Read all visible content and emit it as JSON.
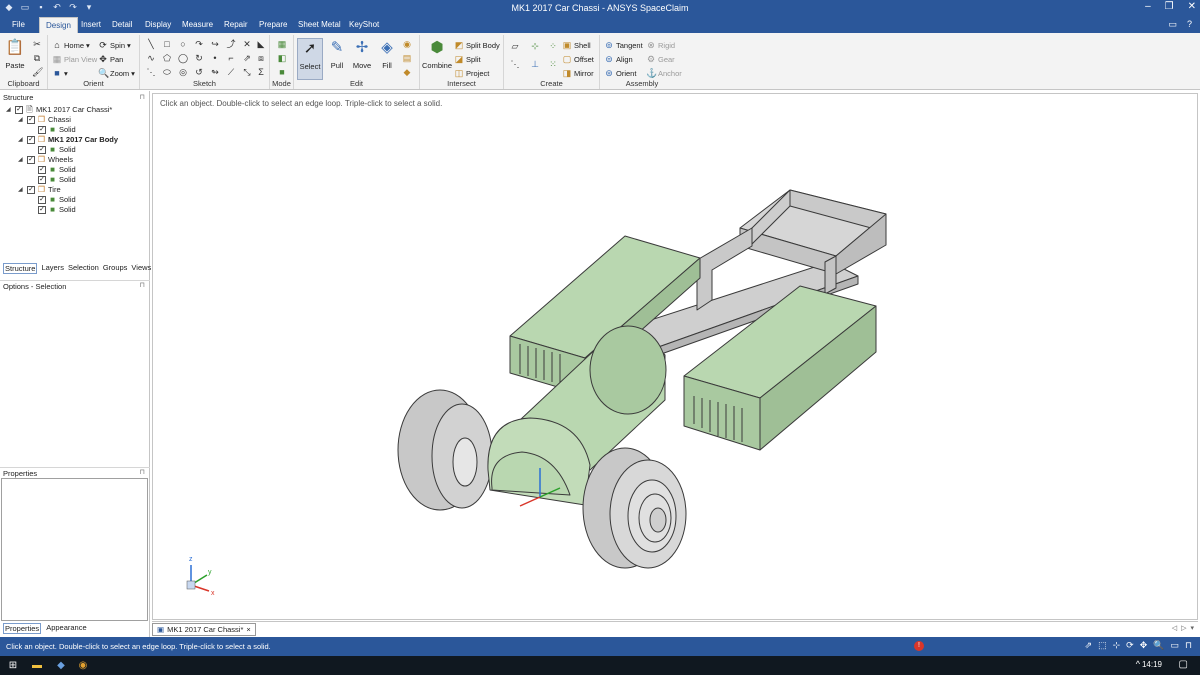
{
  "window": {
    "title": "MK1 2017 Car Chassi - ANSYS SpaceClaim"
  },
  "menu": {
    "tabs": [
      "File",
      "Design",
      "Insert",
      "Detail",
      "Display",
      "Measure",
      "Repair",
      "Prepare",
      "Sheet Metal",
      "KeyShot"
    ],
    "active": "Design"
  },
  "ribbon": {
    "clipboard": {
      "label": "Clipboard",
      "paste": "Paste"
    },
    "orient": {
      "label": "Orient",
      "home": "Home",
      "plan_view": "Plan View",
      "spin": "Spin",
      "pan": "Pan",
      "zoom": "Zoom"
    },
    "sketch": {
      "label": "Sketch"
    },
    "mode": {
      "label": "Mode"
    },
    "edit": {
      "label": "Edit",
      "select": "Select",
      "pull": "Pull",
      "move": "Move",
      "fill": "Fill"
    },
    "intersect": {
      "label": "Intersect",
      "combine": "Combine",
      "split_body": "Split Body",
      "split": "Split",
      "project": "Project"
    },
    "create": {
      "label": "Create",
      "shell": "Shell",
      "offset": "Offset",
      "mirror": "Mirror"
    },
    "assembly": {
      "label": "Assembly",
      "tangent": "Tangent",
      "align": "Align",
      "orient": "Orient",
      "rigid": "Rigid",
      "gear": "Gear",
      "anchor": "Anchor"
    }
  },
  "structure": {
    "header": "Structure",
    "root": "MK1 2017 Car Chassi*",
    "items": [
      {
        "label": "Chassi",
        "bold": false,
        "children": [
          "Solid"
        ]
      },
      {
        "label": "MK1 2017 Car Body",
        "bold": true,
        "children": [
          "Solid"
        ]
      },
      {
        "label": "Wheels",
        "bold": false,
        "children": [
          "Solid",
          "Solid"
        ]
      },
      {
        "label": "Tire",
        "bold": false,
        "children": [
          "Solid",
          "Solid"
        ]
      }
    ],
    "tabs": [
      "Structure",
      "Layers",
      "Selection",
      "Groups",
      "Views"
    ]
  },
  "options": {
    "header": "Options - Selection"
  },
  "properties": {
    "header": "Properties",
    "tabs": [
      "Properties",
      "Appearance"
    ]
  },
  "viewport": {
    "hint": "Click an object. Double-click to select an edge loop. Triple-click to select a solid.",
    "axis_labels": {
      "z": "z",
      "y": "y",
      "x": "x"
    }
  },
  "document_tab": {
    "label": "MK1 2017 Car Chassi*",
    "close": "×"
  },
  "status": {
    "message": "Click an object. Double-click to select an edge loop. Triple-click to select a solid."
  },
  "taskbar": {
    "time": "14:19"
  },
  "colors": {
    "accent": "#2b579a",
    "body_green": "#b9d7b0",
    "chassis_gray": "#cfcfcf",
    "outline": "#3a3a3a"
  }
}
